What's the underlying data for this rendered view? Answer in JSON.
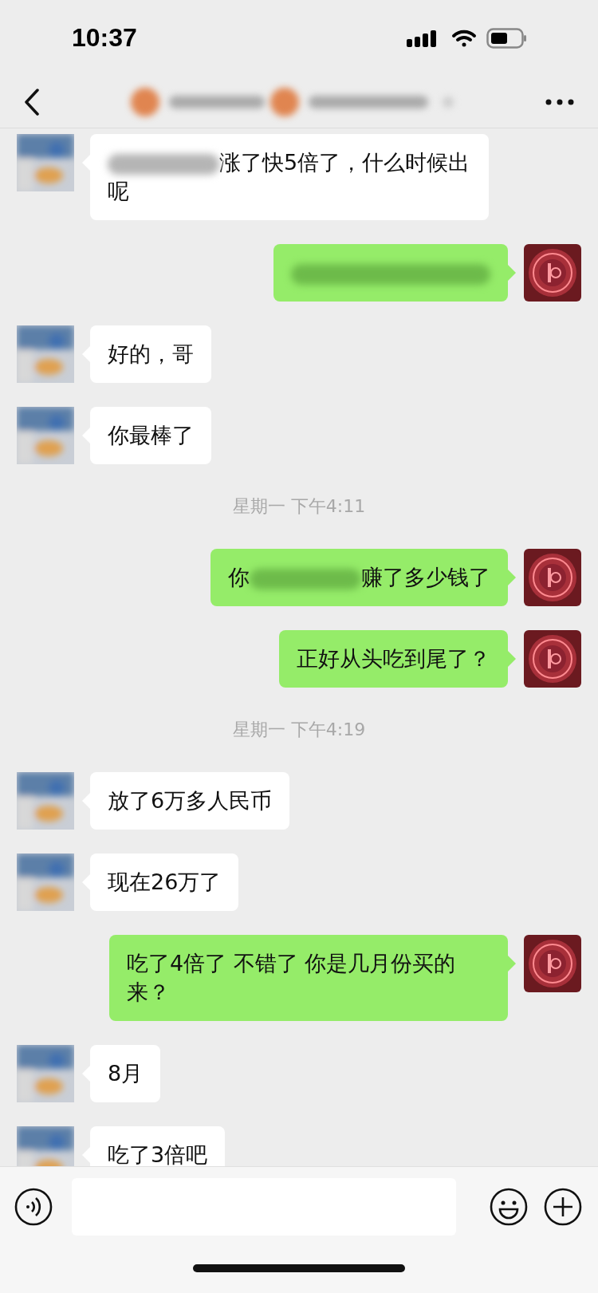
{
  "status_bar": {
    "time": "10:37"
  },
  "messages": [
    {
      "kind": "received",
      "parts": [
        {
          "kind": "blur"
        },
        {
          "kind": "text",
          "text": "涨了快5倍了，什么时候出呢"
        }
      ]
    },
    {
      "kind": "sent",
      "parts": [
        {
          "kind": "blur"
        }
      ]
    },
    {
      "kind": "received",
      "parts": [
        {
          "kind": "text",
          "text": "好的，哥"
        }
      ]
    },
    {
      "kind": "received",
      "parts": [
        {
          "kind": "text",
          "text": "你最棒了"
        }
      ]
    },
    {
      "kind": "time",
      "text": "星期一 下午4:11"
    },
    {
      "kind": "sent",
      "parts": [
        {
          "kind": "text",
          "text": "你"
        },
        {
          "kind": "blur"
        },
        {
          "kind": "text",
          "text": "赚了多少钱了"
        }
      ]
    },
    {
      "kind": "sent",
      "parts": [
        {
          "kind": "text",
          "text": "正好从头吃到尾了？"
        }
      ]
    },
    {
      "kind": "time",
      "text": "星期一 下午4:19"
    },
    {
      "kind": "received",
      "parts": [
        {
          "kind": "text",
          "text": "放了6万多人民币"
        }
      ]
    },
    {
      "kind": "received",
      "parts": [
        {
          "kind": "text",
          "text": "现在26万了"
        }
      ]
    },
    {
      "kind": "sent",
      "parts": [
        {
          "kind": "text",
          "text": "吃了4倍了 不错了 你是几月份买的来？"
        }
      ]
    },
    {
      "kind": "received",
      "parts": [
        {
          "kind": "text",
          "text": "8月"
        }
      ]
    },
    {
      "kind": "received",
      "parts": [
        {
          "kind": "text",
          "text": "吃了3倍吧"
        }
      ]
    }
  ]
}
